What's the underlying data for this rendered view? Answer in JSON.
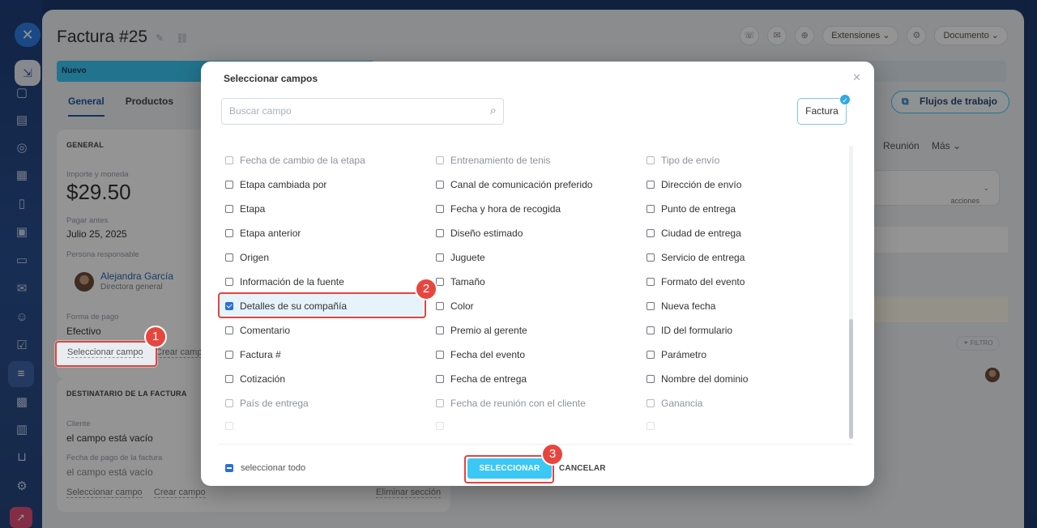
{
  "page": {
    "title": "Factura #25",
    "stage_label": "Nuevo",
    "tabs": [
      "General",
      "Productos"
    ],
    "extensions_label": "Extensiones",
    "document_label": "Documento",
    "workflows_label": "Flujos de trabajo",
    "meeting_label": "Reunión",
    "more_label": "Más",
    "actions_label": "acciones",
    "filter_label": "FILTRO"
  },
  "general_card": {
    "heading": "GENERAL",
    "amount_label": "Importe y moneda",
    "amount_value": "$29.50",
    "due_label": "Pagar antes",
    "due_value": "Julio 25, 2025",
    "responsible_label": "Persona responsable",
    "responsible_name": "Alejandra García",
    "responsible_role": "Directora general",
    "payment_label": "Forma de pago",
    "payment_value": "Efectivo",
    "select_field": "Seleccionar campo",
    "create_field": "Crear camp"
  },
  "recipient_card": {
    "heading": "DESTINATARIO DE LA FACTURA",
    "client_label": "Cliente",
    "client_value": "el campo está vacío",
    "paydate_label": "Fecha de pago de la factura",
    "paydate_value": "el campo está vacío",
    "select_field": "Seleccionar campo",
    "create_field": "Crear campo",
    "delete_section": "Eliminar sección"
  },
  "modal": {
    "title": "Seleccionar campos",
    "search_placeholder": "Buscar campo",
    "entity_tag": "Factura",
    "select_all": "seleccionar todo",
    "select_button": "SELECCIONAR",
    "cancel_button": "CANCELAR",
    "rows": [
      [
        "Fecha de cambio de la etapa",
        "Entrenamiento de tenis",
        "Tipo de envío"
      ],
      [
        "Etapa cambiada por",
        "Canal de comunicación preferido",
        "Dirección de envío"
      ],
      [
        "Etapa",
        "Fecha y hora de recogida",
        "Punto de entrega"
      ],
      [
        "Etapa anterior",
        "Diseño estimado",
        "Ciudad de entrega"
      ],
      [
        "Origen",
        "Juguete",
        "Servicio de entrega"
      ],
      [
        "Información de la fuente",
        "Tamaño",
        "Formato del evento"
      ],
      [
        "Detalles de su compañía",
        "Color",
        "Nueva fecha"
      ],
      [
        "Comentario",
        "Premio al gerente",
        "ID del formulario"
      ],
      [
        "Factura #",
        "Fecha del evento",
        "Parámetro"
      ],
      [
        "Cotización",
        "Fecha de entrega",
        "Nombre del dominio"
      ],
      [
        "País de entrega",
        "Fecha de reunión con el cliente",
        "Ganancia"
      ]
    ],
    "checked_field": "Detalles de su compañía"
  },
  "callouts": [
    "1",
    "2",
    "3"
  ]
}
